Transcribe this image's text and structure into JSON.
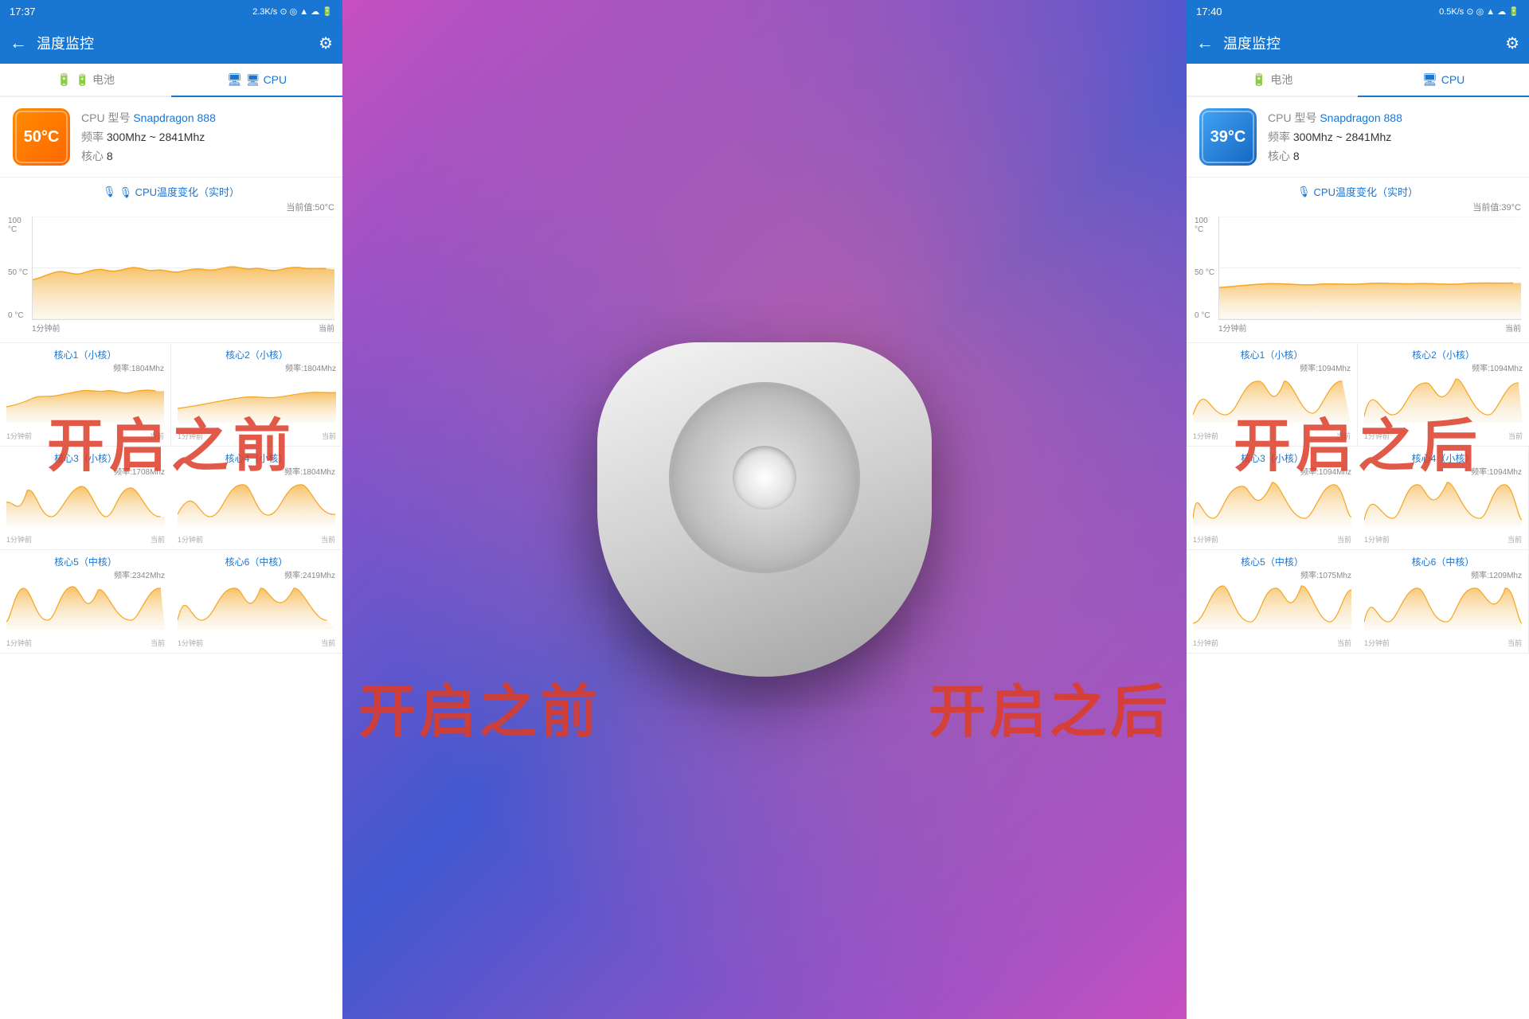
{
  "left_panel": {
    "status_bar": {
      "time": "17:37",
      "icons": "2.3K/s ⊙ ◎ 📶📶 ☁ 🔋",
      "network_speed": "2.3K/s"
    },
    "app_bar": {
      "back_label": "←",
      "title": "温度监控",
      "gear_label": "⚙"
    },
    "tabs": [
      {
        "label": "🔋 电池",
        "active": false
      },
      {
        "label": "🖥 CPU",
        "active": true
      }
    ],
    "cpu_info": {
      "temperature": "50°C",
      "model_label": "CPU 型号",
      "model_value": "Snapdragon 888",
      "freq_label": "频率",
      "freq_value": "300Mhz ~ 2841Mhz",
      "core_label": "核心",
      "core_value": "8"
    },
    "chart": {
      "title": "🎙 CPU温度变化（实时）",
      "current_value_label": "当前值:50°C",
      "y_labels": [
        "100 °C",
        "50 °C",
        "0 °C"
      ],
      "x_labels": [
        "1分钟前",
        "当前"
      ]
    },
    "cores": [
      {
        "label": "核心1（小核）",
        "freq": "频率:1804Mhz"
      },
      {
        "label": "核心2（小核）",
        "freq": "频率:1804Mhz"
      },
      {
        "label": "核心3（小核）",
        "freq": "频率:1708Mhz"
      },
      {
        "label": "核心4（小核）",
        "freq": "频率:1804Mhz"
      },
      {
        "label": "核心5（中核）",
        "freq": "频率:2342Mhz"
      },
      {
        "label": "核心6（中核）",
        "freq": "频率:2419Mhz"
      }
    ],
    "watermark": "开启之前"
  },
  "right_panel": {
    "status_bar": {
      "time": "17:40",
      "network_speed": "0.5K/s"
    },
    "app_bar": {
      "back_label": "←",
      "title": "温度监控",
      "gear_label": "⚙"
    },
    "tabs": [
      {
        "label": "🔋 电池",
        "active": false
      },
      {
        "label": "🖥 CPU",
        "active": true
      }
    ],
    "cpu_info": {
      "temperature": "39°C",
      "model_label": "CPU 型号",
      "model_value": "Snapdragon 888",
      "freq_label": "频率",
      "freq_value": "300Mhz ~ 2841Mhz",
      "core_label": "核心",
      "core_value": "8"
    },
    "chart": {
      "title": "🎙 CPU温度变化（实时）",
      "current_value_label": "当前值:39°C",
      "y_labels": [
        "100 °C",
        "50 °C",
        "0 °C"
      ],
      "x_labels": [
        "1分钟前",
        "当前"
      ]
    },
    "cores": [
      {
        "label": "核心1（小核）",
        "freq": "频率:1094Mhz"
      },
      {
        "label": "核心2（小核）",
        "freq": "频率:1094Mhz"
      },
      {
        "label": "核心3（小核）",
        "freq": "频率:1094Mhz"
      },
      {
        "label": "核心4（小核）",
        "freq": "频率:1094Mhz"
      },
      {
        "label": "核心5（中核）",
        "freq": "频率:1075Mhz"
      },
      {
        "label": "核心6（中核）",
        "freq": "频率:1209Mhz"
      }
    ],
    "watermark": "开启之后"
  }
}
